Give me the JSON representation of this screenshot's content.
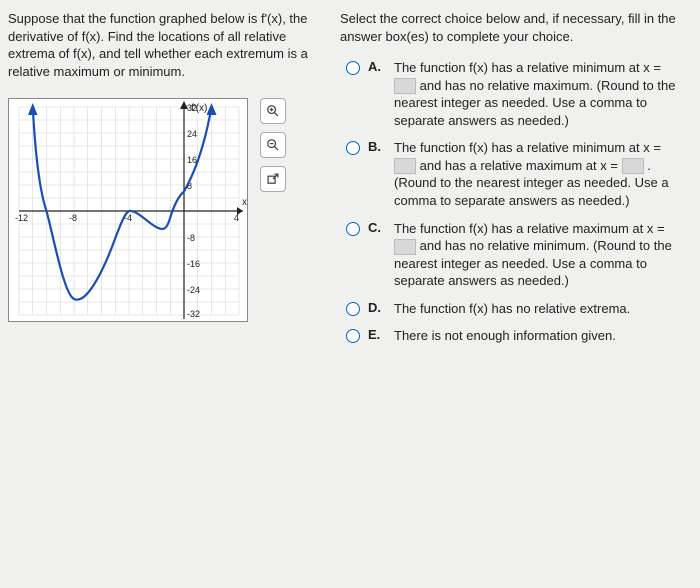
{
  "question": "Suppose that the function graphed below is f'(x), the derivative of f(x). Find the locations of all relative extrema of f(x), and tell whether each extremum is a relative maximum or minimum.",
  "instructions": "Select the correct choice below and, if necessary, fill in the answer box(es) to complete your choice.",
  "graph": {
    "y_label": "f'(x)",
    "x_label": "x"
  },
  "choices": {
    "A": {
      "label": "A.",
      "pre": "The function f(x) has a relative minimum at x =",
      "post": "and has no relative maximum. (Round to the nearest integer as needed. Use a comma to separate answers as needed.)"
    },
    "B": {
      "label": "B.",
      "pre": "The function f(x) has a relative minimum at x =",
      "mid": "and has a relative maximum at x =",
      "post": ". (Round to the nearest integer as needed. Use a comma to separate answers as needed.)"
    },
    "C": {
      "label": "C.",
      "pre": "The function f(x) has a relative maximum at x =",
      "post": "and has no relative minimum. (Round to the nearest integer as needed. Use a comma to separate answers as needed.)"
    },
    "D": {
      "label": "D.",
      "text": "The function f(x) has no relative extrema."
    },
    "E": {
      "label": "E.",
      "text": "There is not enough information given."
    }
  },
  "chart_data": {
    "type": "line",
    "title": "",
    "xlabel": "x",
    "ylabel": "f'(x)",
    "xlim": [
      -12,
      4
    ],
    "ylim": [
      -32,
      32
    ],
    "x_ticks": [
      -12,
      -8,
      -4,
      4
    ],
    "y_ticks": [
      -32,
      -24,
      -16,
      -8,
      8,
      16,
      24,
      32
    ],
    "x": [
      -11,
      -10.5,
      -10,
      -9,
      -8,
      -7,
      -6,
      -5,
      -4,
      -3,
      -2,
      -1,
      0,
      1,
      2,
      3
    ],
    "values": [
      32,
      15,
      0,
      -22,
      -27,
      -22,
      -12,
      -4,
      0,
      -2,
      -5,
      -2,
      6,
      17,
      32,
      50
    ],
    "zero_crossings": [
      -10,
      -4,
      -0.5
    ],
    "notes": "Graph of f'(x). Curve enters from above at x≈-11, crosses zero near x=-10 (pos→neg), reaches local min near x=-8, rises to cross/touch zero near x=-4, dips slightly (remains near/ below zero) near x≈-2, then rises crossing zero near x≈-0.5 (neg→pos) and exits upward.",
    "left_arrow": true,
    "right_arrow": true
  }
}
